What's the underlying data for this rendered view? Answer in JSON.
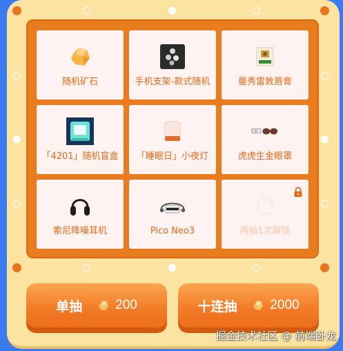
{
  "prizes": [
    {
      "name": "随机矿石",
      "icon": "ore-icon"
    },
    {
      "name": "手机支架-款式随机",
      "icon": "phone-stand-icon"
    },
    {
      "name": "曼秀雷敦唇膏",
      "icon": "lip-balm-icon"
    },
    {
      "name": "「4201」随机盲盒",
      "icon": "blind-box-icon"
    },
    {
      "name": "「睡眠日」小夜灯",
      "icon": "night-light-icon"
    },
    {
      "name": "虎虎生金眼罩",
      "icon": "eye-mask-icon"
    },
    {
      "name": "索尼降噪耳机",
      "icon": "headphones-icon"
    },
    {
      "name": "Pico Neo3",
      "icon": "vr-headset-icon"
    },
    {
      "name": "再抽1次解锁",
      "icon": "earbuds-icon",
      "locked": true
    }
  ],
  "buttons": {
    "single": {
      "label": "单抽",
      "cost": "200"
    },
    "ten": {
      "label": "十连抽",
      "cost": "2000"
    }
  },
  "watermark": "掘金技术社区 @ 前端卧龙",
  "colors": {
    "board": "#e97c1f",
    "frame": "#fde3a1",
    "background": "#3a7bf0",
    "accent": "#e06a17"
  }
}
